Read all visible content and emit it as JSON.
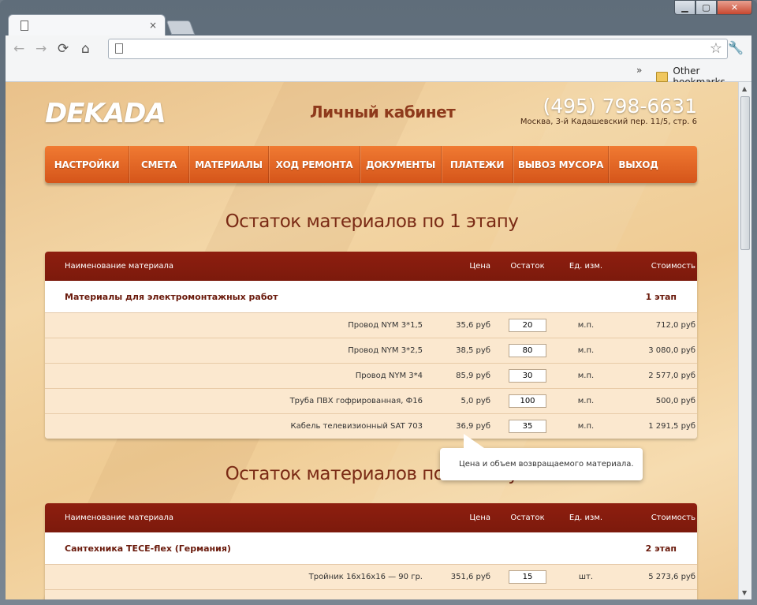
{
  "browser": {
    "tab": {
      "close": "×"
    },
    "nav": {
      "back": "←",
      "forward": "→",
      "reload": "⟳",
      "home": "⌂"
    },
    "address": {
      "value": "",
      "placeholder": ""
    },
    "bookmarks": {
      "overflow": "»",
      "other": "Other bookmarks"
    },
    "window": {
      "minimize": "▁",
      "maximize": "▢",
      "close": "✕"
    }
  },
  "site": {
    "logo": "DEKADA",
    "cabinet": "Личный кабинет",
    "phone": "(495) 798-6631",
    "address": "Москва, 3-й Кадашевский пер. 11/5, стр. 6"
  },
  "menu": [
    {
      "label": "НАСТРОЙКИ",
      "name": "menu-settings"
    },
    {
      "label": "СМЕТА",
      "name": "menu-estimate"
    },
    {
      "label": "МАТЕРИАЛЫ",
      "name": "menu-materials"
    },
    {
      "label": "ХОД РЕМОНТА",
      "name": "menu-progress"
    },
    {
      "label": "ДОКУМЕНТЫ",
      "name": "menu-documents"
    },
    {
      "label": "ПЛАТЕЖИ",
      "name": "menu-payments"
    },
    {
      "label": "ВЫВОЗ МУСОРА",
      "name": "menu-garbage"
    },
    {
      "label": "ВЫХОД",
      "name": "menu-exit"
    }
  ],
  "columns": {
    "name": "Наименование материала",
    "price": "Цена",
    "qty": "Остаток",
    "unit": "Ед. изм.",
    "cost": "Стоимость"
  },
  "section1": {
    "title": "Остаток материалов по 1 этапу",
    "category": "Материалы для электромонтажных работ",
    "stage": "1 этап",
    "rows": [
      {
        "name": "Провод NYM 3*1,5",
        "price": "35,6 руб",
        "qty": "20",
        "unit": "м.п.",
        "cost": "712,0 руб"
      },
      {
        "name": "Провод NYM 3*2,5",
        "price": "38,5 руб",
        "qty": "80",
        "unit": "м.п.",
        "cost": "3 080,0 руб"
      },
      {
        "name": "Провод NYM 3*4",
        "price": "85,9 руб",
        "qty": "30",
        "unit": "м.п.",
        "cost": "2 577,0 руб"
      },
      {
        "name": "Труба ПВХ гофрированная, Ф16",
        "price": "5,0 руб",
        "qty": "100",
        "unit": "м.п.",
        "cost": "500,0 руб"
      },
      {
        "name": "Кабель телевизионный SAT 703",
        "price": "36,9 руб",
        "qty": "35",
        "unit": "м.п.",
        "cost": "1 291,5 руб"
      }
    ]
  },
  "tooltip": "Цена и объем возвращаемого материала.",
  "section2": {
    "title": "Остаток материалов по 2 этапу",
    "category": "Сантехника TECE-flex (Германия)",
    "stage": "2 этап",
    "rows": [
      {
        "name": "Тройник 16x16x16 — 90 гр.",
        "price": "351,6 руб",
        "qty": "15",
        "unit": "шт.",
        "cost": "5 273,6 руб"
      }
    ]
  }
}
